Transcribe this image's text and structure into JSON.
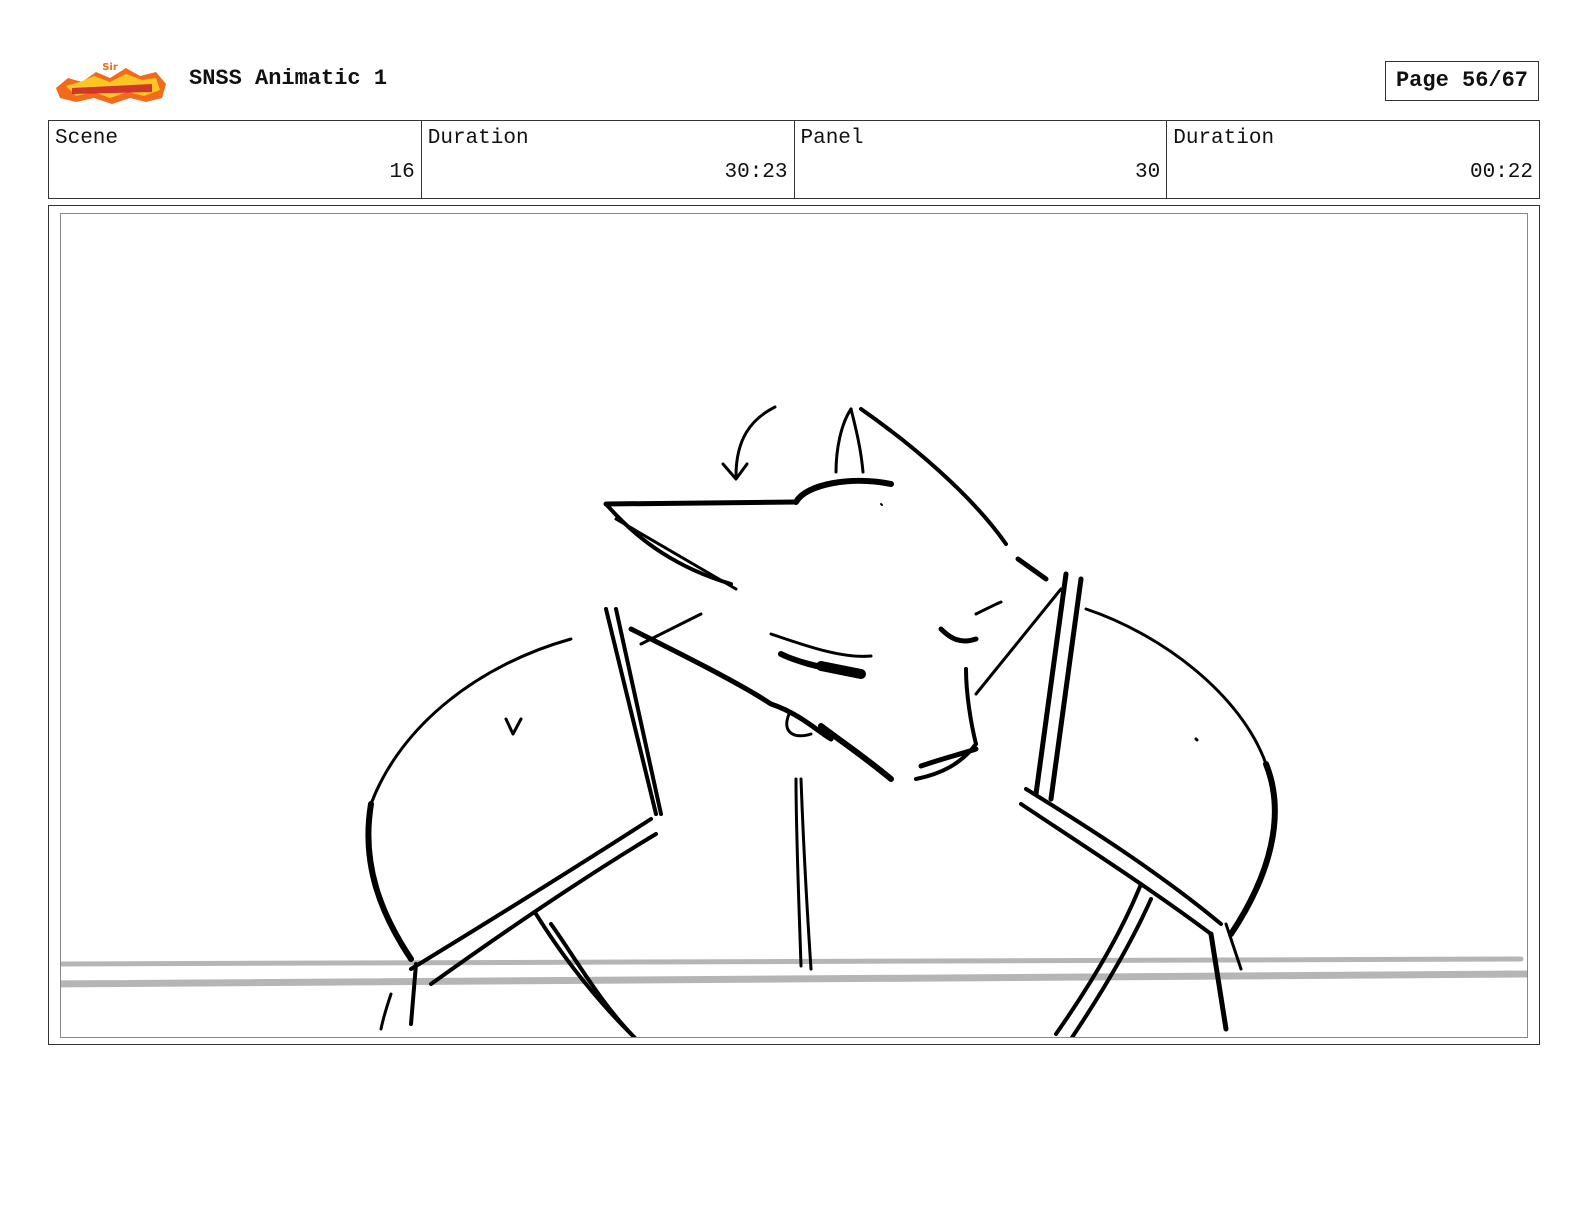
{
  "header": {
    "title": "SNSS Animatic 1",
    "page_label": "Page 56/67",
    "logo_colors": [
      "#f26a1b",
      "#f9c623",
      "#c8102e"
    ]
  },
  "info": {
    "scene_label": "Scene",
    "scene_value": "16",
    "duration_label": "Duration",
    "duration_value": "30:23",
    "panel_label": "Panel",
    "panel_value": "30",
    "panel_duration_label": "Duration",
    "panel_duration_value": "00:22"
  },
  "panel": {
    "drawing": "sketch-figure-leaning-over-table"
  }
}
